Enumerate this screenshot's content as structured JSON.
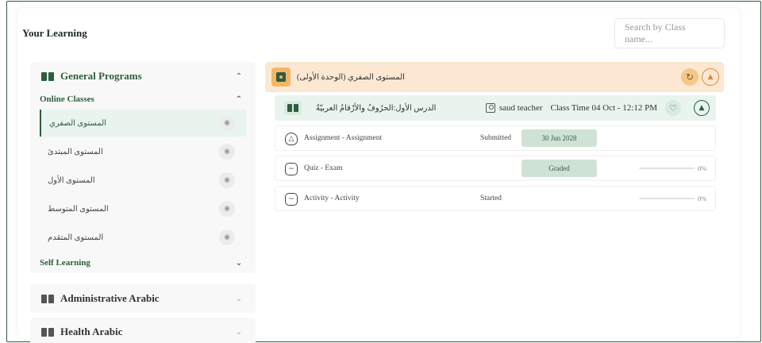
{
  "header": {
    "title": "Your Learning",
    "search_placeholder": "Search by Class name..."
  },
  "sidebar": {
    "program": {
      "label": "General Programs"
    },
    "online_classes": {
      "label": "Online Classes"
    },
    "classes": [
      {
        "label": "المستوى الصفري",
        "active": true
      },
      {
        "label": "المستوى المبتدئ"
      },
      {
        "label": "المستوى الأول"
      },
      {
        "label": "المستوى المتوسط"
      },
      {
        "label": "المستوى المتقدم"
      }
    ],
    "self_learning": {
      "label": "Self Learning"
    },
    "other_programs": [
      {
        "label": "Administrative Arabic"
      },
      {
        "label": "Health Arabic"
      }
    ]
  },
  "main": {
    "level": {
      "title": "المستوى الصفري (الوحدة الأولى)"
    },
    "lesson": {
      "title": "الدرس الأول:الحرُوفُ والأرْقامُ العربيّةُ",
      "teacher": "saud teacher",
      "class_time": "Class Time 04 Oct - 12:12 PM"
    },
    "activities": [
      {
        "label": "Assignment - Assignment",
        "status": "Submitted",
        "pill": "30 Jun 2028",
        "progress": ""
      },
      {
        "label": "Quiz - Exam",
        "status": "",
        "pill": "Graded",
        "progress": "0%"
      },
      {
        "label": "Activity - Activity",
        "status": "Started",
        "pill": "",
        "progress": "0%"
      }
    ]
  },
  "colors": {
    "primary": "#2e5d3f",
    "level_bg": "#fce8d2",
    "lesson_bg": "#e9f4ee"
  }
}
